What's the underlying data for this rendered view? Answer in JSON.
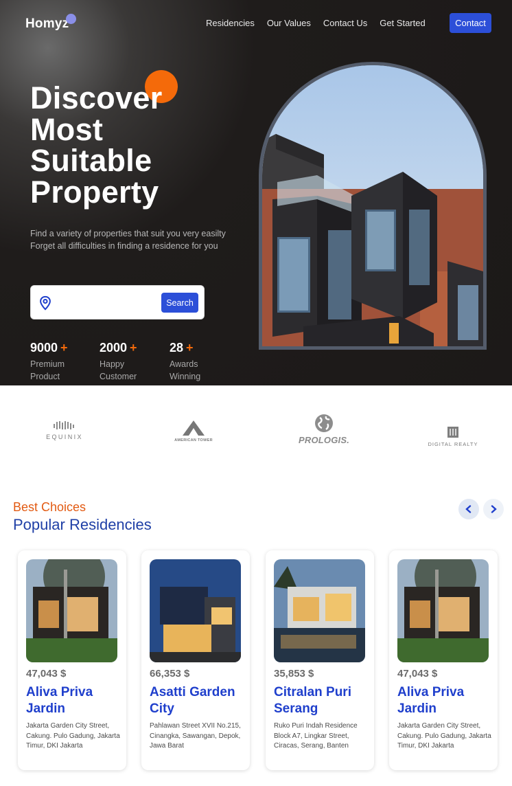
{
  "header": {
    "logo": "Homyz",
    "nav": [
      "Residencies",
      "Our Values",
      "Contact Us",
      "Get Started"
    ],
    "contact_button": "Contact"
  },
  "hero": {
    "title_lines": [
      "Discover",
      "Most",
      "Suitable",
      "Property"
    ],
    "description": "Find a variety of properties that suit you very easilty Forget all difficulties in finding a residence for you",
    "search_placeholder": "",
    "search_button": "Search",
    "stats": [
      {
        "number": "9000",
        "plus": "+",
        "label_line1": "Premium",
        "label_line2": "Product"
      },
      {
        "number": "2000",
        "plus": "+",
        "label_line1": "Happy",
        "label_line2": "Customer"
      },
      {
        "number": "28",
        "plus": "+",
        "label_line1": "Awards",
        "label_line2": "Winning"
      }
    ]
  },
  "companies": {
    "equinix": "EQUINIX",
    "american_tower": "AMERICAN TOWER",
    "prologis": "PROLOGIS.",
    "digital_realty": "DIGITAL REALTY"
  },
  "residencies": {
    "subtitle": "Best Choices",
    "title": "Popular Residencies",
    "prev_icon": "chevron-left-icon",
    "next_icon": "chevron-right-icon",
    "cards": [
      {
        "price": "47,043 $",
        "name": "Aliva Priva Jardin",
        "address": "Jakarta Garden City Street, Cakung. Pulo Gadung, Jakarta Timur, DKI Jakarta"
      },
      {
        "price": "66,353 $",
        "name": "Asatti Garden City",
        "address": "Pahlawan Street XVII No.215, Cinangka, Sawangan, Depok, Jawa Barat"
      },
      {
        "price": "35,853 $",
        "name": "Citralan Puri Serang",
        "address": "Ruko Puri Indah Residence Block A7, Lingkar Street, Ciracas, Serang, Banten"
      },
      {
        "price": "47,043 $",
        "name": "Aliva Priva Jardin",
        "address": "Jakarta Garden City Street, Cakung. Pulo Gadung, Jakarta Timur, DKI Jakarta"
      }
    ]
  },
  "colors": {
    "accent": "#2c4fd8",
    "orange": "#f46a0a",
    "title_blue": "#1f3fa6",
    "hero_bg": "#1c1918"
  }
}
